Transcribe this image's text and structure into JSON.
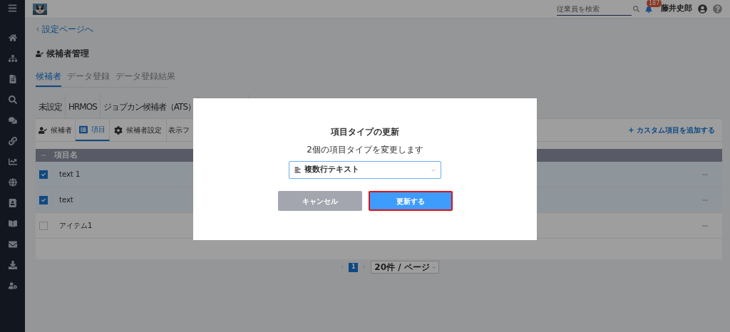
{
  "header": {
    "search": {
      "placeholder": "従業員を検索"
    },
    "notification_count": "187",
    "user_name": "藤井史郎"
  },
  "breadcrumb": "設定ページへ",
  "page_title": "候補者管理",
  "tabs": [
    {
      "label": "候補者",
      "selected": true
    },
    {
      "label": "データ登録",
      "selected": false
    },
    {
      "label": "データ登録結果",
      "selected": false
    }
  ],
  "source_tabs": [
    {
      "label": "未設定",
      "selected": false
    },
    {
      "label": "HRMOS",
      "selected": false
    },
    {
      "label": "ジョブカン候補者（ATS）",
      "selected": false
    }
  ],
  "sub_tabs": [
    {
      "label": "候補者",
      "kind": "user",
      "selected": false
    },
    {
      "label": "項目",
      "kind": "list",
      "selected": true
    },
    {
      "label": "候補者設定",
      "kind": "gear",
      "selected": false
    },
    {
      "label": "表示フ",
      "kind": "plain",
      "selected": false
    }
  ],
  "add_custom_link": "+ カスタム項目を追加する",
  "table": {
    "columns": [
      "項目名"
    ],
    "rows": [
      {
        "name": "text 1",
        "checked": true
      },
      {
        "name": "text",
        "checked": true
      },
      {
        "name": "アイテム1",
        "checked": false
      }
    ]
  },
  "pagination": {
    "pages": [
      {
        "label": "1",
        "selected": true
      }
    ],
    "page_size": "20件 / ページ"
  },
  "dialog": {
    "title": "項目タイプの更新",
    "message": "2個の項目タイプを変更します",
    "select": {
      "value": "複数行テキスト"
    },
    "buttons": [
      {
        "label": "キャンセル",
        "kind": "secondary",
        "highlighted": false
      },
      {
        "label": "更新する",
        "kind": "primary",
        "highlighted": true
      }
    ]
  }
}
